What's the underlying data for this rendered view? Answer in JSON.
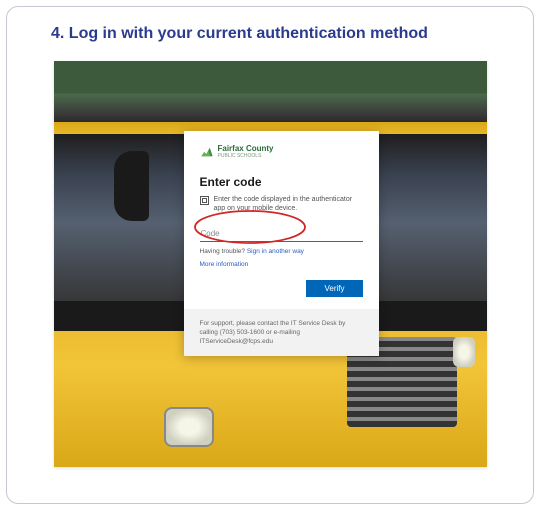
{
  "step": {
    "number_label": "4. Log in with your current authentication method"
  },
  "login": {
    "org_name": "Fairfax County",
    "org_sub": "PUBLIC SCHOOLS",
    "heading": "Enter code",
    "instruction": "Enter the code displayed in the authenticator app on your mobile device.",
    "code_placeholder": "Code",
    "trouble_prefix": "Having trouble? ",
    "trouble_link": "Sign in another way",
    "more_info": "More information",
    "verify": "Verify",
    "support": "For support, please contact the IT Service Desk by calling (703) 503-1600 or e-mailing ITServiceDesk@fcps.edu"
  }
}
